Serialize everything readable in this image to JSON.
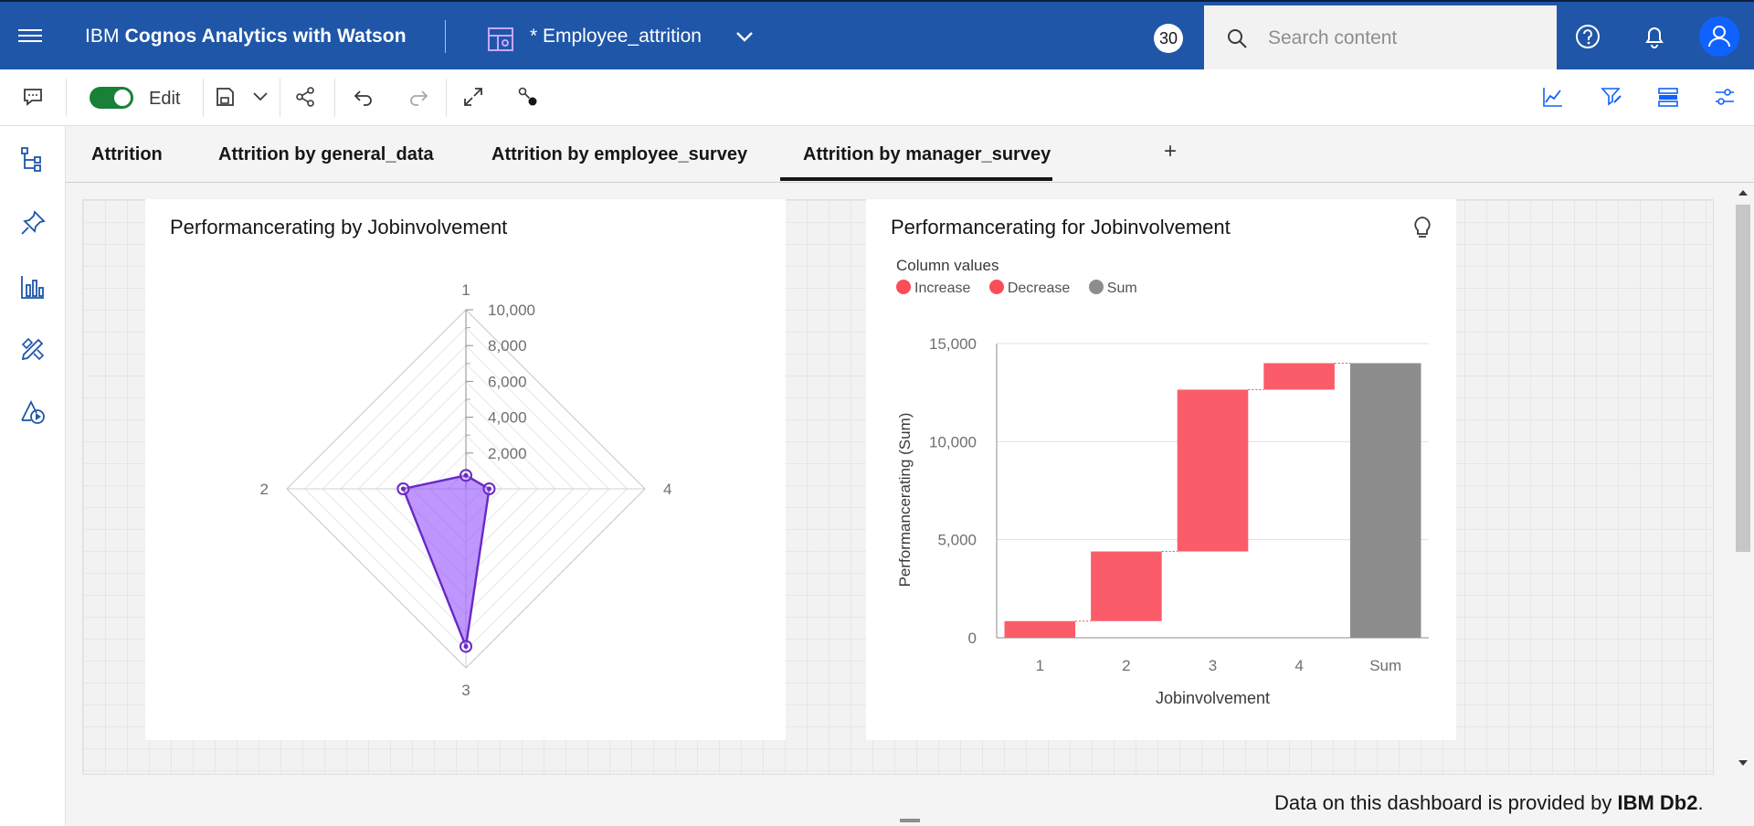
{
  "header": {
    "brand_prefix": "IBM ",
    "brand_bold": "Cognos Analytics with Watson",
    "document_title": "* Employee_attrition",
    "count_badge": "30",
    "search_placeholder": "Search content"
  },
  "toolbar": {
    "edit_label": "Edit"
  },
  "tabs": [
    {
      "label": "Attrition"
    },
    {
      "label": "Attrition by general_data"
    },
    {
      "label": "Attrition by employee_survey"
    },
    {
      "label": "Attrition by manager_survey"
    }
  ],
  "tab_add_label": "+",
  "radar_card": {
    "title": "Performancerating by Jobinvolvement"
  },
  "waterfall_card": {
    "title": "Performancerating for Jobinvolvement",
    "legend_title": "Column values",
    "legend": [
      {
        "label": "Increase",
        "color": "#fa5c6a"
      },
      {
        "label": "Decrease",
        "color": "#fa4d56"
      },
      {
        "label": "Sum",
        "color": "#8d8d8d"
      }
    ]
  },
  "footer": {
    "prefix": "Data on this dashboard is provided by ",
    "bold": "IBM Db2",
    "suffix": "."
  },
  "chart_data": [
    {
      "type": "radar",
      "title": "Performancerating by Jobinvolvement",
      "categories": [
        "1",
        "2",
        "3",
        "4"
      ],
      "values": [
        750,
        3500,
        8800,
        1300
      ],
      "radial_ticks": [
        "2,000",
        "4,000",
        "6,000",
        "8,000",
        "10,000"
      ],
      "rmax": 10000,
      "fill_color": "#8a3ffc"
    },
    {
      "type": "bar",
      "subtype": "waterfall",
      "title": "Performancerating for Jobinvolvement",
      "categories": [
        "1",
        "2",
        "3",
        "4",
        "Sum"
      ],
      "values": [
        850,
        3550,
        8250,
        1350,
        14000
      ],
      "xlabel": "Jobinvolvement",
      "ylabel": "Performancerating (Sum)",
      "ylim": [
        0,
        15000
      ],
      "yticks": [
        "0",
        "5,000",
        "10,000",
        "15,000"
      ],
      "increase_color": "#fa5c6a",
      "sum_color": "#8d8d8d"
    }
  ]
}
